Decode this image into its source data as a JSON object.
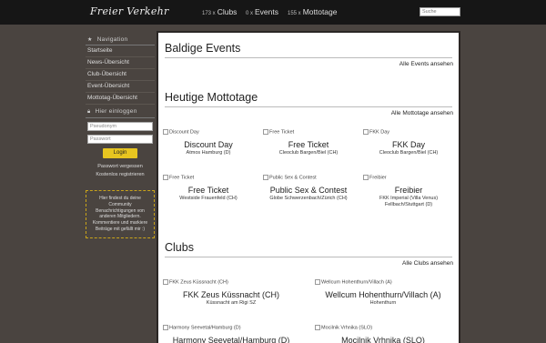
{
  "header": {
    "logo": "Freier Verkehr",
    "stats": [
      {
        "num": "173 x",
        "label": "Clubs"
      },
      {
        "num": "0 x",
        "label": "Events"
      },
      {
        "num": "155 x",
        "label": "Mottotage"
      }
    ],
    "search_placeholder": "Suche"
  },
  "sidebar": {
    "nav_heading": "Navigation",
    "nav_items": [
      "Startseite",
      "News-Übersicht",
      "Club-Übersicht",
      "Event-Übersicht",
      "Mottotag-Übersicht"
    ],
    "login_heading": "Hier einloggen",
    "username_placeholder": "Pseudonym",
    "password_placeholder": "Passwort",
    "login_button": "Login",
    "forgot_password": "Passwort vergessen",
    "register": "Kostenlos registrieren",
    "info_text": "Hier findest du deine Community Benachrichtigungen von anderen Mitgliedern. Kommentiere und markiere Beiträge mit gefällt mir :)"
  },
  "events": {
    "title": "Baldige Events",
    "link": "Alle Events ansehen"
  },
  "mottotage": {
    "title": "Heutige Mottotage",
    "link": "Alle Mottotage ansehen",
    "cards": [
      {
        "alt": "Discount Day",
        "title": "Discount Day",
        "sub": "Atmos Hamburg (D)"
      },
      {
        "alt": "Free Ticket",
        "title": "Free Ticket",
        "sub": "Cleoclub Bargen/Biel (CH)"
      },
      {
        "alt": "FKK Day",
        "title": "FKK Day",
        "sub": "Cleoclub Bargen/Biel (CH)"
      },
      {
        "alt": "Free Ticket",
        "title": "Free Ticket",
        "sub": "Westside Frauenfeld (CH)"
      },
      {
        "alt": "Public Sex & Contest",
        "title": "Public Sex & Contest",
        "sub": "Globe Schwerzenbach/Zürich (CH)"
      },
      {
        "alt": "Freibier",
        "title": "Freibier",
        "sub": "FKK Imperial (Villa Venus) Fellbach/Stuttgart (D)"
      }
    ]
  },
  "clubs": {
    "title": "Clubs",
    "link": "Alle Clubs ansehen",
    "cards": [
      {
        "alt": "FKK Zeus Küssnacht (CH)",
        "title": "FKK Zeus Küssnacht (CH)",
        "sub": "Küssnacht am Rigi SZ"
      },
      {
        "alt": "Wellcum Hohenthurn/Villach (A)",
        "title": "Wellcum Hohenthurn/Villach (A)",
        "sub": "Hohenthurn"
      },
      {
        "alt": "Harmony Seevetal/Hamburg (D)",
        "title": "Harmony Seevetal/Hamburg (D)",
        "sub": ""
      },
      {
        "alt": "Mocilnik Vrhnika (SLO)",
        "title": "Mocilnik Vrhnika (SLO)",
        "sub": ""
      }
    ]
  }
}
